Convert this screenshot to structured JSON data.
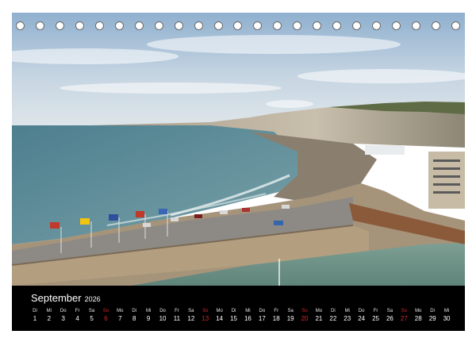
{
  "calendar": {
    "month": "September",
    "year": "2026",
    "days": [
      {
        "weekday": "Di",
        "date": "1",
        "sunday": false
      },
      {
        "weekday": "Mi",
        "date": "2",
        "sunday": false
      },
      {
        "weekday": "Do",
        "date": "3",
        "sunday": false
      },
      {
        "weekday": "Fr",
        "date": "4",
        "sunday": false
      },
      {
        "weekday": "Sa",
        "date": "5",
        "sunday": false
      },
      {
        "weekday": "So",
        "date": "6",
        "sunday": true
      },
      {
        "weekday": "Mo",
        "date": "7",
        "sunday": false
      },
      {
        "weekday": "Di",
        "date": "8",
        "sunday": false
      },
      {
        "weekday": "Mi",
        "date": "9",
        "sunday": false
      },
      {
        "weekday": "Do",
        "date": "10",
        "sunday": false
      },
      {
        "weekday": "Fr",
        "date": "11",
        "sunday": false
      },
      {
        "weekday": "Sa",
        "date": "12",
        "sunday": false
      },
      {
        "weekday": "So",
        "date": "13",
        "sunday": true
      },
      {
        "weekday": "Mo",
        "date": "14",
        "sunday": false
      },
      {
        "weekday": "Di",
        "date": "15",
        "sunday": false
      },
      {
        "weekday": "Mi",
        "date": "16",
        "sunday": false
      },
      {
        "weekday": "Do",
        "date": "17",
        "sunday": false
      },
      {
        "weekday": "Fr",
        "date": "18",
        "sunday": false
      },
      {
        "weekday": "Sa",
        "date": "19",
        "sunday": false
      },
      {
        "weekday": "So",
        "date": "20",
        "sunday": true
      },
      {
        "weekday": "Mo",
        "date": "21",
        "sunday": false
      },
      {
        "weekday": "Di",
        "date": "22",
        "sunday": false
      },
      {
        "weekday": "Mi",
        "date": "23",
        "sunday": false
      },
      {
        "weekday": "Do",
        "date": "24",
        "sunday": false
      },
      {
        "weekday": "Fr",
        "date": "25",
        "sunday": false
      },
      {
        "weekday": "Sa",
        "date": "26",
        "sunday": false
      },
      {
        "weekday": "So",
        "date": "27",
        "sunday": true
      },
      {
        "weekday": "Mo",
        "date": "28",
        "sunday": false
      },
      {
        "weekday": "Di",
        "date": "29",
        "sunday": false
      },
      {
        "weekday": "Mi",
        "date": "30",
        "sunday": false
      }
    ]
  },
  "colors": {
    "calendar_background": "#000000",
    "sunday_text": "#d6262b",
    "weekday_text": "#ffffff"
  },
  "binding": {
    "ring_count": 23,
    "icon": "spiral-ring-icon"
  }
}
